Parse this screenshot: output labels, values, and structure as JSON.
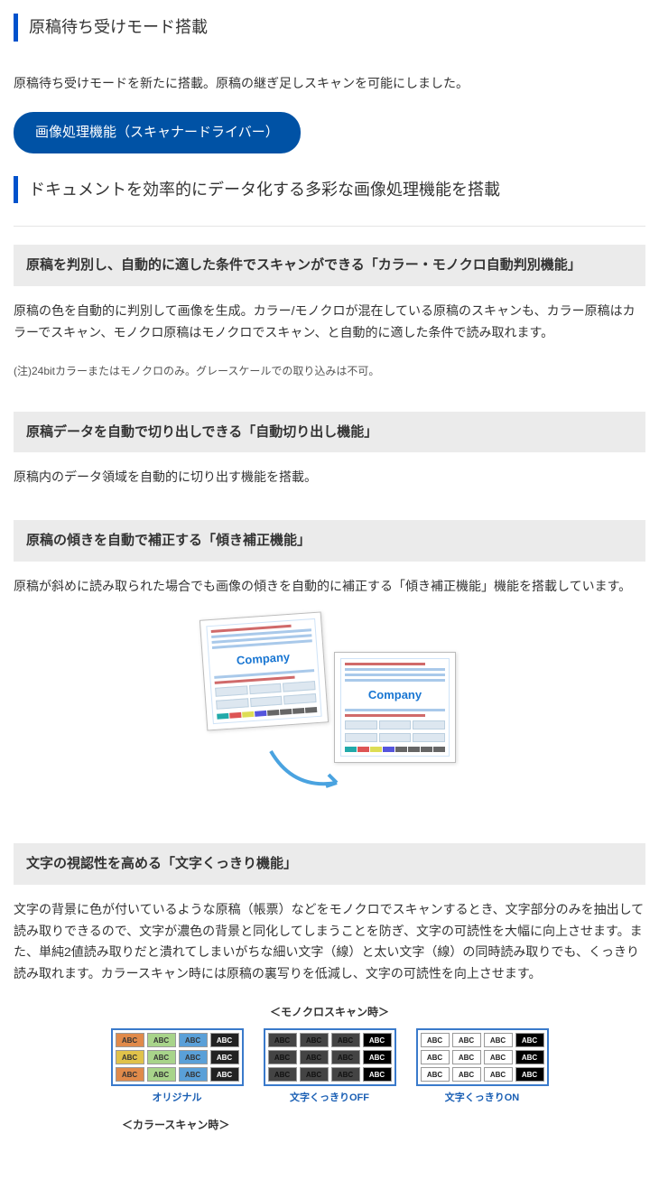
{
  "section1": {
    "heading": "原稿待ち受けモード搭載",
    "text": "原稿待ち受けモードを新たに搭載。原稿の継ぎ足しスキャンを可能にしました。"
  },
  "pill": {
    "label": "画像処理機能（スキャナードライバー）"
  },
  "section2": {
    "heading": "ドキュメントを効率的にデータ化する多彩な画像処理機能を搭載"
  },
  "feat1": {
    "heading": "原稿を判別し、自動的に適した条件でスキャンができる「カラー・モノクロ自動判別機能」",
    "text": "原稿の色を自動的に判別して画像を生成。カラー/モノクロが混在している原稿のスキャンも、カラー原稿はカラーでスキャン、モノクロ原稿はモノクロでスキャン、と自動的に適した条件で読み取れます。",
    "note": "(注)24bitカラーまたはモノクロのみ。グレースケールでの取り込みは不可。"
  },
  "feat2": {
    "heading": "原稿データを自動で切り出しできる「自動切り出し機能」",
    "text": "原稿内のデータ領域を自動的に切り出す機能を搭載。"
  },
  "feat3": {
    "heading": "原稿の傾きを自動で補正する「傾き補正機能」",
    "text": "原稿が斜めに読み取られた場合でも画像の傾きを自動的に補正する「傾き補正機能」機能を搭載しています。",
    "doc_title": "Company"
  },
  "feat4": {
    "heading": "文字の視認性を高める「文字くっきり機能」",
    "text": "文字の背景に色が付いているような原稿（帳票）などをモノクロでスキャンするとき、文字部分のみを抽出して読み取りできるので、文字が濃色の背景と同化してしまうことを防ぎ、文字の可読性を大幅に向上させます。また、単純2値読み取りだと潰れてしまいがちな細い文字（線）と太い文字（線）の同時読み取りでも、くっきり読み取れます。カラースキャン時には原稿の裏写りを低減し、文字の可読性を向上させます。",
    "subhead_mono": "＜モノクロスキャン時＞",
    "subhead_color": "＜カラースキャン時＞",
    "cap_original": "オリジナル",
    "cap_off": "文字くっきりOFF",
    "cap_on": "文字くっきりON",
    "cell_label": "ABC"
  }
}
